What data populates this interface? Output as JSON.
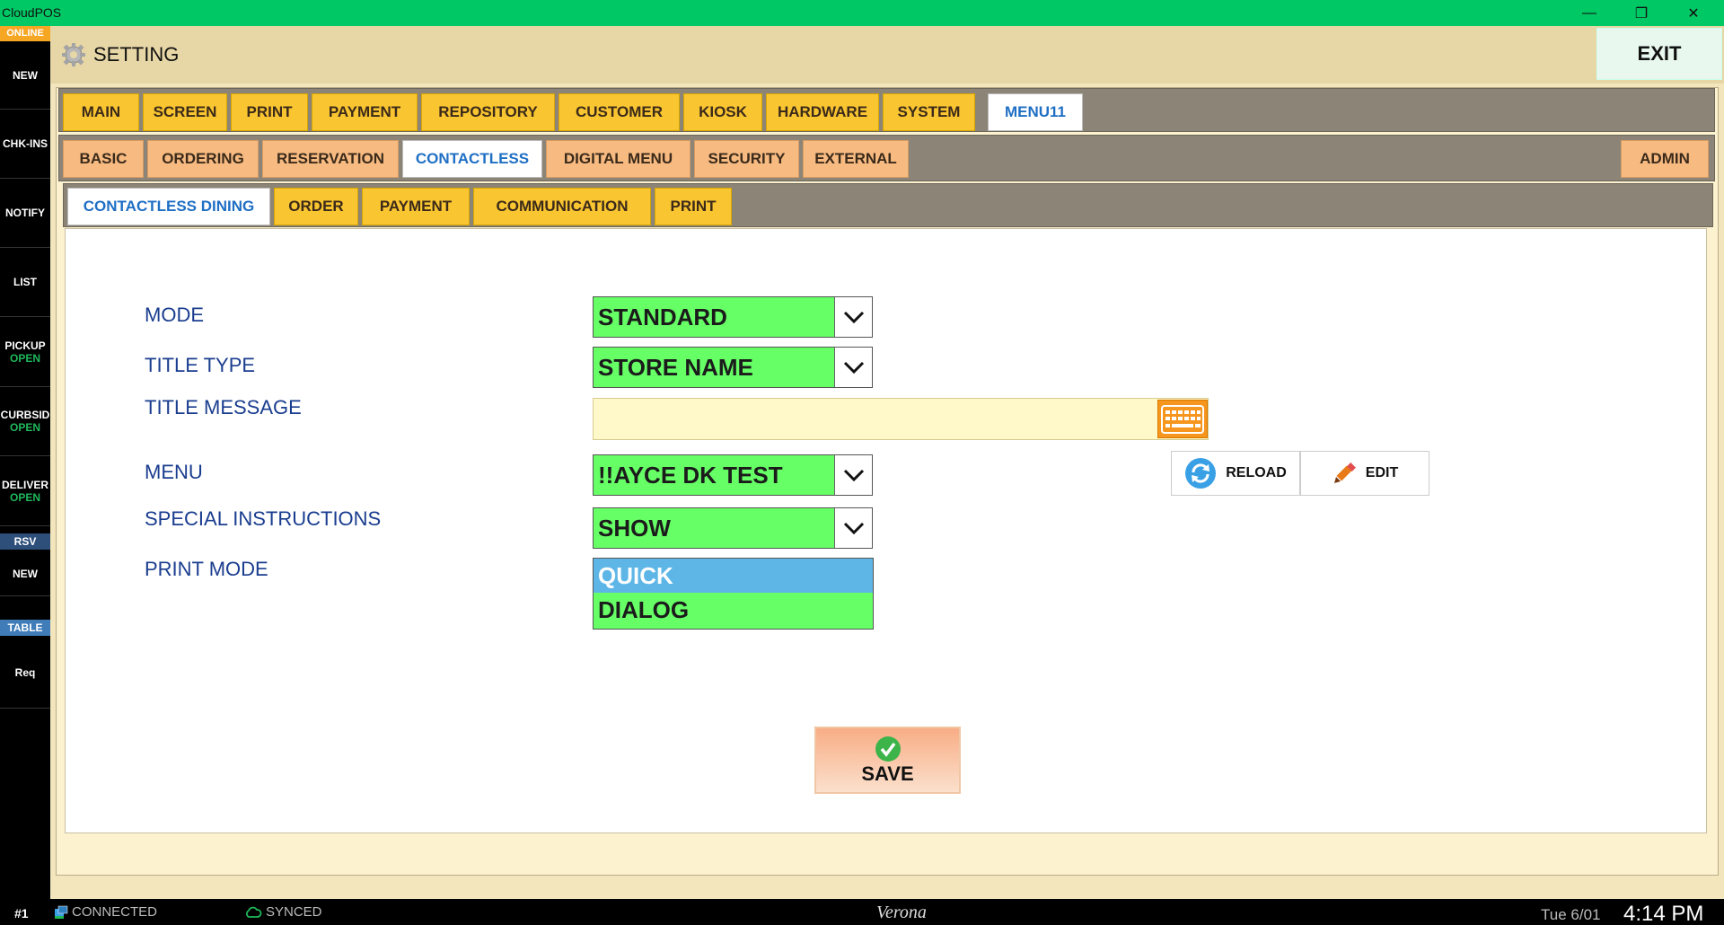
{
  "window": {
    "title": "CloudPOS",
    "min": "—",
    "max": "❐",
    "close": "✕"
  },
  "sidebar": {
    "status": "ONLINE",
    "items": [
      {
        "label": "NEW",
        "sub": ""
      },
      {
        "label": "CHK-INS",
        "sub": ""
      },
      {
        "label": "NOTIFY",
        "sub": ""
      },
      {
        "label": "LIST",
        "sub": ""
      },
      {
        "label": "PICKUP",
        "sub": "OPEN"
      },
      {
        "label": "CURBSID",
        "sub": "OPEN"
      },
      {
        "label": "DELIVER",
        "sub": "OPEN"
      }
    ],
    "rsv_header": "RSV",
    "rsv_new": "NEW",
    "table_header": "TABLE",
    "req": "Req"
  },
  "header": {
    "title": "SETTING",
    "exit_label": "EXIT",
    "icon": "gear-icon"
  },
  "tabs_main": [
    "MAIN",
    "SCREEN",
    "PRINT",
    "PAYMENT",
    "REPOSITORY",
    "CUSTOMER",
    "KIOSK",
    "HARDWARE",
    "SYSTEM",
    "MENU11"
  ],
  "tabs_main_active": "MENU11",
  "tabs_sub": [
    "BASIC",
    "ORDERING",
    "RESERVATION",
    "CONTACTLESS",
    "DIGITAL MENU",
    "SECURITY",
    "EXTERNAL"
  ],
  "tabs_sub_active": "CONTACTLESS",
  "tab_admin": "ADMIN",
  "tabs_contactless": [
    "CONTACTLESS DINING",
    "ORDER",
    "PAYMENT",
    "COMMUNICATION",
    "PRINT"
  ],
  "tabs_contactless_active": "CONTACTLESS DINING",
  "form": {
    "mode": {
      "label": "MODE",
      "value": "STANDARD"
    },
    "title_type": {
      "label": "TITLE TYPE",
      "value": "STORE NAME"
    },
    "title_message": {
      "label": "TITLE MESSAGE",
      "value": ""
    },
    "menu": {
      "label": "MENU",
      "value": "!!AYCE DK TEST"
    },
    "special_instructions": {
      "label": "SPECIAL INSTRUCTIONS",
      "value": "SHOW"
    },
    "print_mode": {
      "label": "PRINT MODE",
      "options": [
        "QUICK",
        "DIALOG"
      ],
      "selected": "QUICK"
    }
  },
  "buttons": {
    "reload": "RELOAD",
    "edit": "EDIT",
    "save": "SAVE"
  },
  "colors": {
    "titlebar": "#00c864",
    "tab": "#f9c530",
    "select": "#66ff66",
    "selected_option": "#5eb6e7",
    "label": "#1a3d8f"
  },
  "statusbar": {
    "terminal": "#1",
    "connection": "CONNECTED",
    "sync": "SYNCED",
    "store": "Verona",
    "date": "Tue 6/01",
    "time": "4:14 PM"
  }
}
